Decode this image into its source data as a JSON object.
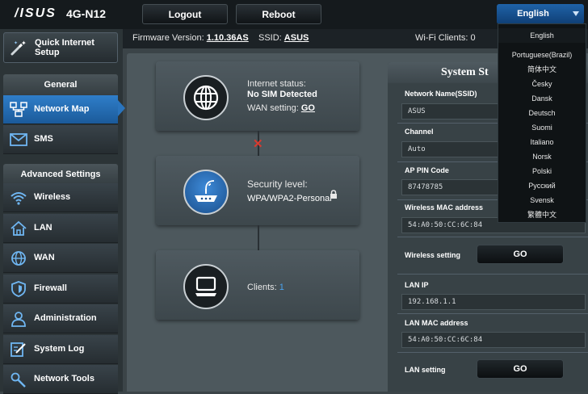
{
  "header": {
    "brand": "/ISUS",
    "model": "4G-N12",
    "logout_label": "Logout",
    "reboot_label": "Reboot",
    "language_current": "English"
  },
  "info": {
    "firmware_label": "Firmware Version:",
    "firmware_value": "1.10.36AS",
    "ssid_label": "SSID:",
    "ssid_value": "ASUS",
    "wifi_clients_label": "Wi-Fi Clients:",
    "wifi_clients_value": "0"
  },
  "sidebar": {
    "quick_setup": "Quick Internet Setup",
    "general_header": "General",
    "general_items": [
      {
        "label": "Network Map",
        "icon": "network-map-icon",
        "active": true
      },
      {
        "label": "SMS",
        "icon": "envelope-icon"
      }
    ],
    "advanced_header": "Advanced Settings",
    "advanced_items": [
      {
        "label": "Wireless",
        "icon": "wifi-icon"
      },
      {
        "label": "LAN",
        "icon": "home-icon"
      },
      {
        "label": "WAN",
        "icon": "globe-icon"
      },
      {
        "label": "Firewall",
        "icon": "shield-icon"
      },
      {
        "label": "Administration",
        "icon": "user-icon"
      },
      {
        "label": "System Log",
        "icon": "log-icon"
      },
      {
        "label": "Network Tools",
        "icon": "tools-icon"
      }
    ]
  },
  "map": {
    "internet_status_label": "Internet status:",
    "internet_status_value": "No SIM Detected",
    "wan_setting_label": "WAN setting:",
    "wan_setting_link": "GO",
    "security_label": "Security level:",
    "security_value": "WPA/WPA2-Personal",
    "clients_label": "Clients:",
    "clients_value": "1"
  },
  "system_status": {
    "title": "System St",
    "network_name_label": "Network Name(SSID)",
    "network_name_value": "ASUS",
    "channel_label": "Channel",
    "channel_value": "Auto",
    "ap_pin_label": "AP PIN Code",
    "ap_pin_value": "87478785",
    "wireless_mac_label": "Wireless MAC address",
    "wireless_mac_value": "54:A0:50:CC:6C:84",
    "wireless_setting_label": "Wireless setting",
    "wireless_go": "GO",
    "lan_ip_label": "LAN IP",
    "lan_ip_value": "192.168.1.1",
    "lan_mac_label": "LAN MAC address",
    "lan_mac_value": "54:A0:50:CC:6C:84",
    "lan_setting_label": "LAN setting",
    "lan_go": "GO"
  },
  "languages": [
    "English",
    "Portuguese(Brazil)",
    "简体中文",
    "Česky",
    "Dansk",
    "Deutsch",
    "Suomi",
    "Italiano",
    "Norsk",
    "Polski",
    "Русский",
    "Svensk",
    "繁體中文"
  ],
  "colors": {
    "accent_blue": "#2f7ec9",
    "disconnected_red": "#d93a2f",
    "clients_blue": "#4aa3f0"
  }
}
